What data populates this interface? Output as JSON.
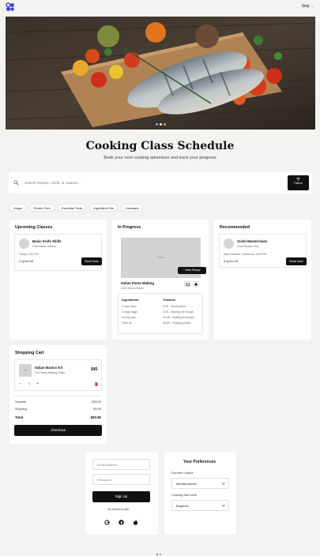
{
  "header": {
    "skip_label": "Skip →"
  },
  "hero": {
    "slide_count": 3,
    "active_slide": 1
  },
  "page": {
    "title": "Cooking Class Schedule",
    "subtitle": "Book your next cooking adventure and track your progress"
  },
  "search": {
    "placeholder": "Search recipes, chefs, or classes...",
    "filters_label": "Filters"
  },
  "chips": [
    "Vegan",
    "Gluten-Free",
    "Essential Tools",
    "Ingredient Kits",
    "Cookware"
  ],
  "upcoming": {
    "title": "Upcoming Classes",
    "class_name": "Basic Knife Skills",
    "chef": "Chef Maria Santos",
    "when": "Today, 2:00 PM",
    "spots": "2 spots left",
    "button": "Book Now"
  },
  "in_progress": {
    "title": "In Progress",
    "video_placeholder": "Video",
    "save_recipe": "Save Recipe",
    "class_name": "Italian Pasta Making",
    "chef": "Chef Marco Rossi",
    "ingredients_title": "Ingredients",
    "ingredients": [
      "2 cups flour",
      "3 large eggs",
      "1/2 tsp salt",
      "Olive oil"
    ],
    "timeline_title": "Timeline",
    "timeline": [
      "0:00 - Introduction",
      "2:30 - Making the dough",
      "15:45 - Rolling technique",
      "28:00 - Shaping pasta"
    ]
  },
  "recommended": {
    "title": "Recommended",
    "class_name": "Sushi Masterclass",
    "chef": "Chef Tanaka Yuki",
    "when": "Next Session: Tomorrow, 3:00 PM",
    "spots": "8 spots left",
    "button": "Book Now"
  },
  "cart": {
    "title": "Shopping Cart",
    "item_thumb": "Kit",
    "item_name": "Italian Basics Kit",
    "item_sub": "For Pasta Making Class",
    "item_price": "$45",
    "quantity": "1",
    "summary": [
      {
        "label": "Subtotal",
        "value": "$45.00"
      },
      {
        "label": "Shipping",
        "value": "$5.99"
      }
    ],
    "total_label": "Total",
    "total_value": "$50.99",
    "checkout_label": "Checkout"
  },
  "signup": {
    "email_placeholder": "Email Address",
    "password_placeholder": "Password",
    "button": "Sign Up",
    "continue_with": "Or continue with"
  },
  "preferences": {
    "title": "Your Preferences",
    "cuisine_label": "Favorite Cuisine",
    "cuisine_value": "Mediterranean",
    "skill_label": "Cooking Skill Level",
    "skill_value": "Beginner"
  },
  "colors": {
    "accent": "#3b3bd6",
    "primary": "#111111",
    "danger": "#d93030",
    "background": "#f3f3f1"
  }
}
